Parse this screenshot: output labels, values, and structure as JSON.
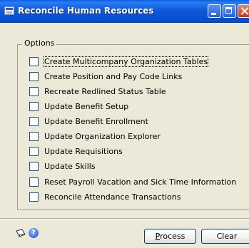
{
  "window": {
    "title": "Reconcile Human Resources"
  },
  "options_group": {
    "legend": "Options",
    "items": [
      {
        "label": "Create Multicompany Organization Tables",
        "checked": false,
        "focused": true
      },
      {
        "label": "Create Position and Pay Code Links",
        "checked": false
      },
      {
        "label": "Recreate Redlined Status Table",
        "checked": false
      },
      {
        "label": "Update Benefit Setup",
        "checked": false
      },
      {
        "label": "Update Benefit Enrollment",
        "checked": false
      },
      {
        "label": "Update Organization Explorer",
        "checked": false
      },
      {
        "label": "Update Requisitions",
        "checked": false
      },
      {
        "label": "Update Skills",
        "checked": false
      },
      {
        "label": "Reset Payroll Vacation and Sick Time Information",
        "checked": false
      },
      {
        "label": "Reconcile Attendance Transactions",
        "checked": false
      }
    ]
  },
  "footer": {
    "note_icon": "note-icon",
    "help_icon": "help-icon",
    "help_glyph": "?",
    "process_accel": "P",
    "process_rest": "rocess",
    "clear_label": "Clear"
  }
}
